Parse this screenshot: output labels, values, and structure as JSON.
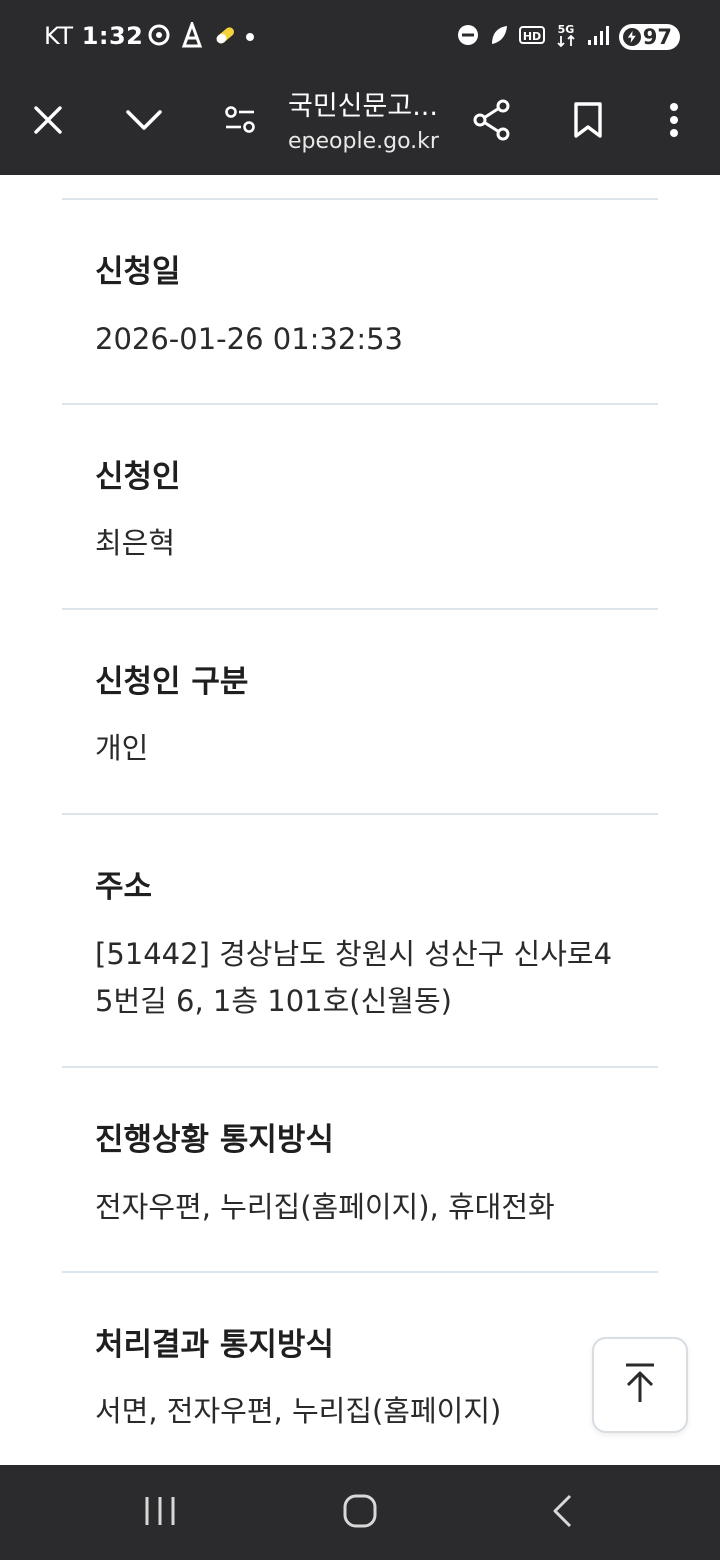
{
  "status_bar": {
    "carrier": "KT",
    "time": "1:32",
    "battery": "97"
  },
  "toolbar": {
    "title": "국민신문고...",
    "url": "epeople.go.kr",
    "icons": [
      "close-icon",
      "chevron-down-icon",
      "site-settings-icon",
      "share-icon",
      "bookmark-icon",
      "more-vert-icon"
    ]
  },
  "fields": [
    {
      "label": "신청일",
      "value": "2026-01-26 01:32:53"
    },
    {
      "label": "신청인",
      "value": "최은혁"
    },
    {
      "label": "신청인 구분",
      "value": "개인"
    },
    {
      "label": "주소",
      "value_line1": "[51442] 경상남도 창원시 성산구 신사로4",
      "value_line2": "5번길 6, 1층 101호(신월동)"
    },
    {
      "label": "진행상황 통지방식",
      "value": "전자우편, 누리집(홈페이지), 휴대전화"
    },
    {
      "label": "처리결과 통지방식",
      "value": "서면, 전자우편, 누리집(홈페이지)"
    }
  ],
  "colors": {
    "chrome": "#2b2b2d",
    "divider": "#dde5ec",
    "text": "#2a2a2a"
  }
}
